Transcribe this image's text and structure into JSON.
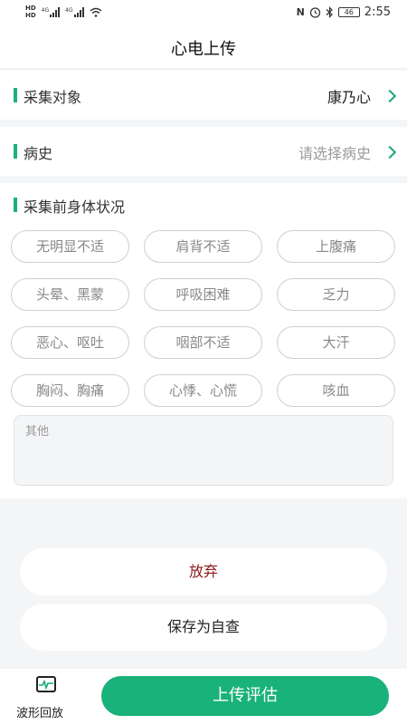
{
  "status": {
    "time": "2:55",
    "battery": "46",
    "network1": "4G",
    "network2": "4G"
  },
  "header": {
    "title": "心电上传"
  },
  "subject": {
    "label": "采集对象",
    "value": "康乃心"
  },
  "history": {
    "label": "病史",
    "placeholder": "请选择病史"
  },
  "condition": {
    "label": "采集前身体状况",
    "options": [
      "无明显不适",
      "肩背不适",
      "上腹痛",
      "头晕、黑蒙",
      "呼吸困难",
      "乏力",
      "恶心、呕吐",
      "咽部不适",
      "大汗",
      "胸闷、胸痛",
      "心悸、心慌",
      "咳血"
    ],
    "other_placeholder": "其他"
  },
  "actions": {
    "discard": "放弃",
    "save": "保存为自查"
  },
  "bottom": {
    "wave_label": "波形回放",
    "upload": "上传评估"
  },
  "colors": {
    "accent": "#19b27a",
    "discard_text": "#8b1a1a"
  }
}
